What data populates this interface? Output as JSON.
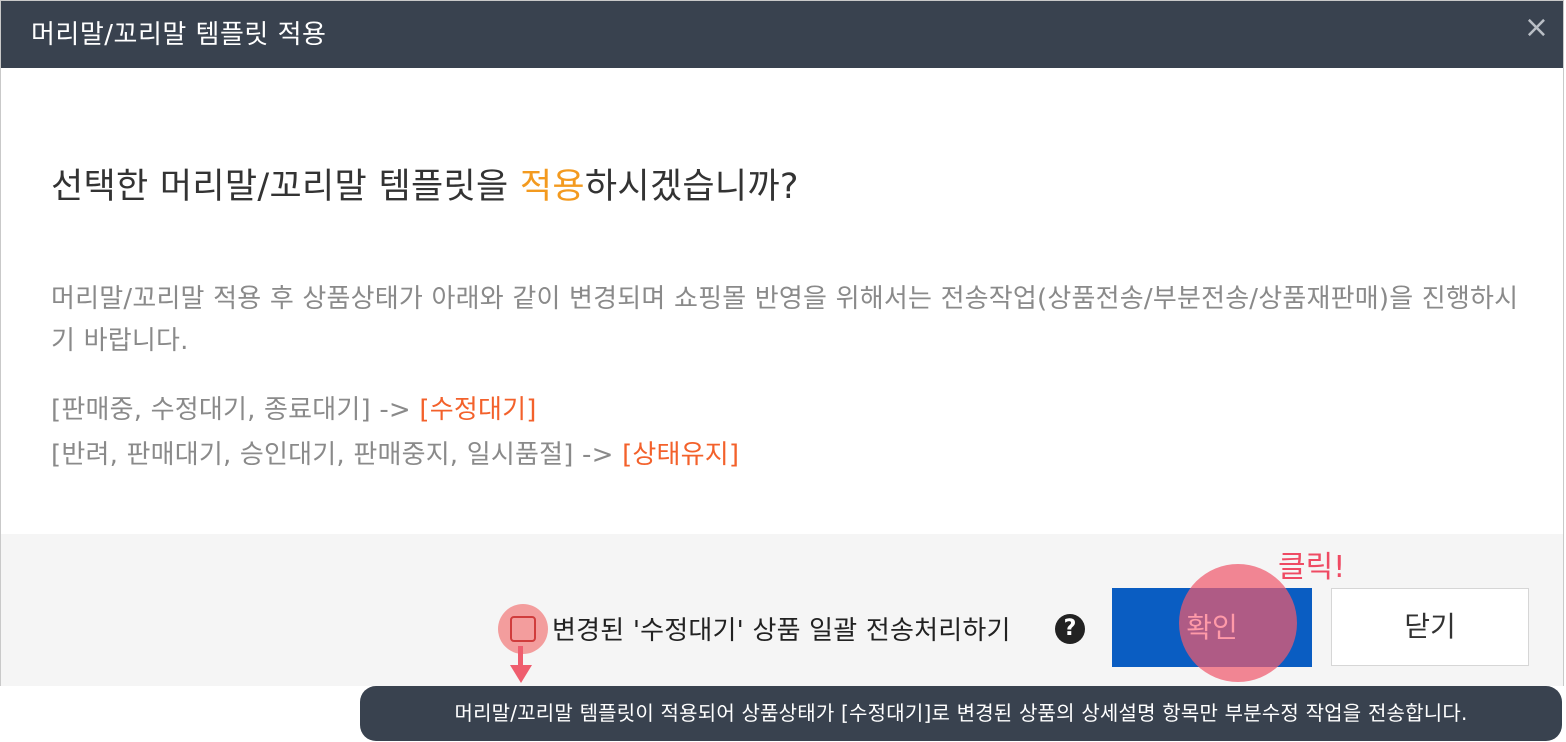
{
  "dialog": {
    "title": "머리말/꼬리말 템플릿 적용",
    "close_icon": "×",
    "question_prefix": "선택한 머리말/꼬리말 템플릿을 ",
    "question_highlight": "적용",
    "question_suffix": "하시겠습니까?",
    "description": "머리말/꼬리말 적용 후 상품상태가 아래와 같이 변경되며 쇼핑몰 반영을 위해서는 전송작업(상품전송/부분전송/상품재판매)을 진행하시기 바랍니다.",
    "rules": [
      {
        "from": "[판매중, 수정대기, 종료대기] -> ",
        "to": "[수정대기]"
      },
      {
        "from": "[반려, 판매대기, 승인대기, 판매중지, 일시품절] -> ",
        "to": "[상태유지]"
      }
    ]
  },
  "footer": {
    "checkbox_label": "변경된 '수정대기' 상품 일괄 전송처리하기",
    "help_icon": "?",
    "confirm_label": "확인",
    "close_label": "닫기"
  },
  "annotation": {
    "click_label": "클릭!",
    "tooltip": "머리말/꼬리말 템플릿이 적용되어 상품상태가 [수정대기]로 변경된 상품의 상세설명 항목만 부분수정 작업을 전송합니다."
  },
  "colors": {
    "header_bg": "#39424f",
    "highlight": "#f39a1f",
    "result": "#f3612b",
    "confirm_bg": "#0a5dc2",
    "annotation": "#ef4a63"
  }
}
